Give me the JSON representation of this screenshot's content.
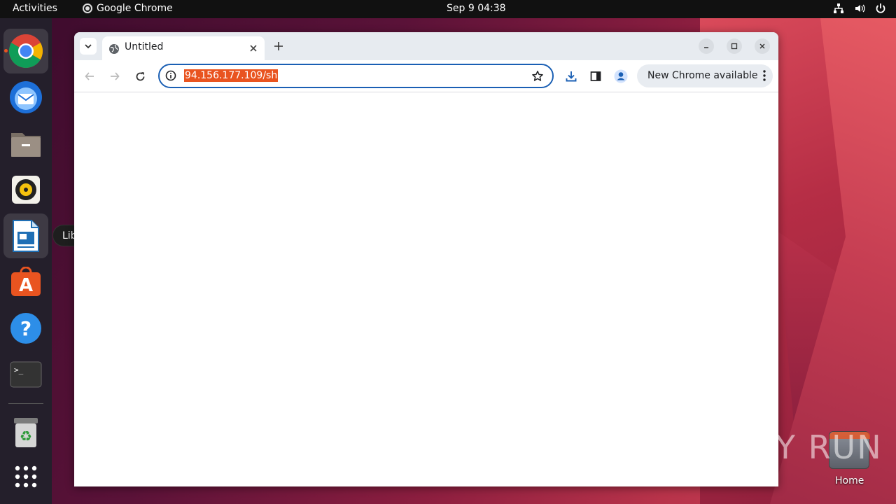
{
  "topbar": {
    "activities": "Activities",
    "app_name": "Google Chrome",
    "clock": "Sep 9  04:38"
  },
  "dock": {
    "items": [
      "Google Chrome",
      "Thunderbird Mail",
      "Files",
      "Rhythmbox",
      "LibreOffice Writer",
      "Ubuntu Software",
      "Help",
      "Terminal",
      "Trash",
      "Show Applications"
    ],
    "tooltip": "LibreOffice Writer"
  },
  "browser": {
    "tab_title": "Untitled",
    "url": "94.156.177.109/sh",
    "update_chip": "New Chrome available"
  },
  "desktop": {
    "watermark": "ANY RUN",
    "home_label": "Home"
  },
  "colors": {
    "accent": "#e95420",
    "omnibox_focus": "#1a5fb4",
    "dock_bg": "#241f2b"
  }
}
